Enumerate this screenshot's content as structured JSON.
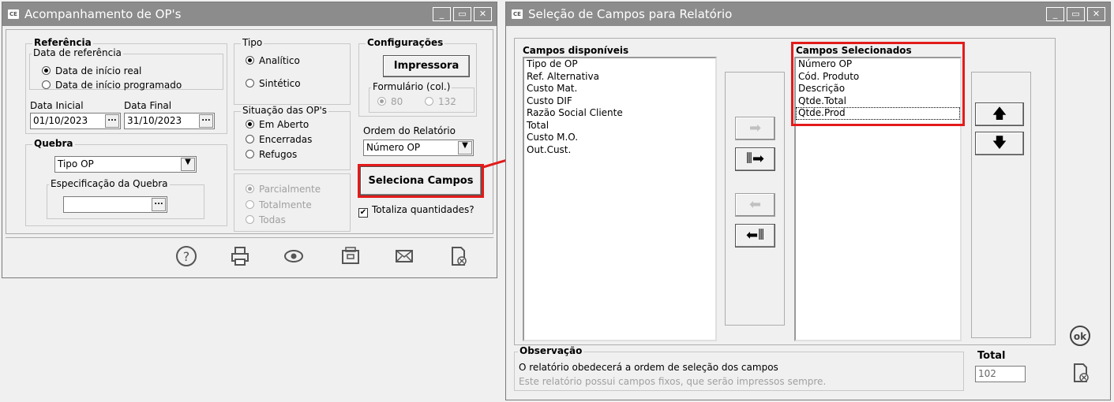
{
  "left_window": {
    "title": "Acompanhamento de OP's",
    "app_icon": "CE",
    "referencia": {
      "title": "Referência",
      "data_ref_title": "Data de referência",
      "opt_real": "Data de início real",
      "opt_prog": "Data de início programado",
      "data_inicial_label": "Data Inicial",
      "data_final_label": "Data Final",
      "data_inicial": "01/10/2023",
      "data_final": "31/10/2023"
    },
    "tipo": {
      "title": "Tipo",
      "analitico": "Analítico",
      "sintetico": "Sintético"
    },
    "situacao": {
      "title": "Situação das OP's",
      "aberto": "Em Aberto",
      "encerradas": "Encerradas",
      "refugos": "Refugos"
    },
    "parcial": {
      "parcialmente": "Parcialmente",
      "totalmente": "Totalmente",
      "todas": "Todas"
    },
    "config": {
      "title": "Configurações",
      "impressora": "Impressora",
      "formulario_title": "Formulário (col.)",
      "opt80": "80",
      "opt132": "132",
      "ordem_label": "Ordem do Relatório",
      "ordem_value": "Número OP",
      "seleciona": "Seleciona Campos",
      "totaliza": "Totaliza quantidades?"
    },
    "quebra": {
      "title": "Quebra",
      "value": "Tipo OP",
      "espec_title": "Especificação da Quebra",
      "espec_value": ""
    },
    "dots": "..."
  },
  "right_window": {
    "title": "Seleção de Campos para Relatório",
    "app_icon": "CE",
    "disponiveis_title": "Campos disponíveis",
    "disponiveis": [
      "Tipo de OP",
      "Ref. Alternativa",
      "Custo Mat.",
      "Custo DIF",
      "Razão Social Cliente",
      "Total",
      "Custo M.O.",
      "Out.Cust."
    ],
    "selecionados_title": "Campos Selecionados",
    "selecionados": [
      "Número OP",
      "Cód. Produto",
      "Descrição",
      "Qtde.Total",
      "Qtde.Prod"
    ],
    "observacao_title": "Observação",
    "observacao_1": "O relatório obedecerá a ordem de seleção dos campos",
    "observacao_2": "Este relatório possui campos fixos, que serão impressos sempre.",
    "total_label": "Total",
    "total_value": "102",
    "ok_label": "ok"
  },
  "colors": {
    "highlight": "#e31b1b",
    "titlebar": "#8c8c8c"
  }
}
